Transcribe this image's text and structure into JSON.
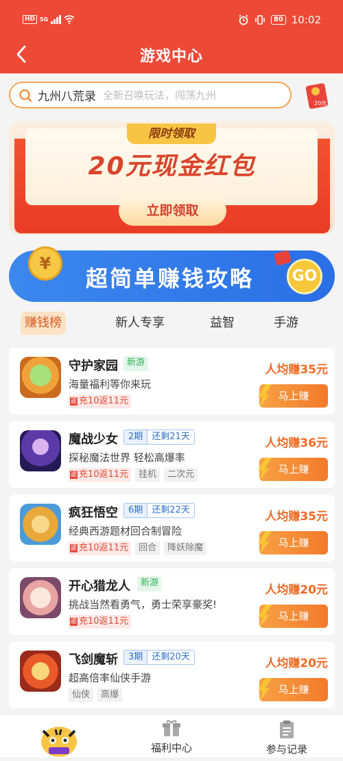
{
  "status": {
    "network": "HD",
    "signal": "5G",
    "battery": "80",
    "time": "10:02"
  },
  "header": {
    "title": "游戏中心"
  },
  "search": {
    "query": "九州八荒录",
    "placeholder": "全新召唤玩法，闯荡九州"
  },
  "gift": {
    "label": "20元"
  },
  "banner": {
    "tag": "限时领取",
    "headline": "20元现金红包",
    "button": "立即领取"
  },
  "guide": {
    "coin": "¥",
    "title": "超简单赚钱攻略",
    "go": "GO"
  },
  "tabs": [
    "赚钱榜",
    "新人专享",
    "益智",
    "手游"
  ],
  "games": [
    {
      "name": "守护家园",
      "badge": "新游",
      "desc": "海量福利等你来玩",
      "tags": [
        "充10返11元"
      ],
      "earn": "人均赚35元",
      "button": "马上赚"
    },
    {
      "name": "魔战少女",
      "period": "2期",
      "remain": "还剩21天",
      "desc": "探秘魔法世界 轻松高爆率",
      "tags": [
        "充10返11元",
        "挂机",
        "二次元"
      ],
      "earn": "人均赚36元",
      "button": "马上赚"
    },
    {
      "name": "疯狂悟空",
      "period": "6期",
      "remain": "还剩22天",
      "desc": "经典西游题材回合制冒险",
      "tags": [
        "充10返11元",
        "回合",
        "降妖除魔"
      ],
      "earn": "人均赚35元",
      "button": "马上赚"
    },
    {
      "name": "开心猎龙人",
      "badge": "新游",
      "desc": "挑战当然看勇气，勇士荣享豪奖!",
      "tags": [
        "充10返11元"
      ],
      "earn": "人均赚20元",
      "button": "马上赚"
    },
    {
      "name": "飞剑魔斩",
      "period": "3期",
      "remain": "还剩20天",
      "desc": "超高倍率仙侠手游",
      "tags": [
        "仙侠",
        "高爆"
      ],
      "earn": "人均赚20元",
      "button": "马上赚"
    }
  ],
  "refund_mark": "返",
  "bottom": {
    "welfare": "福利中心",
    "records": "参与记录"
  }
}
